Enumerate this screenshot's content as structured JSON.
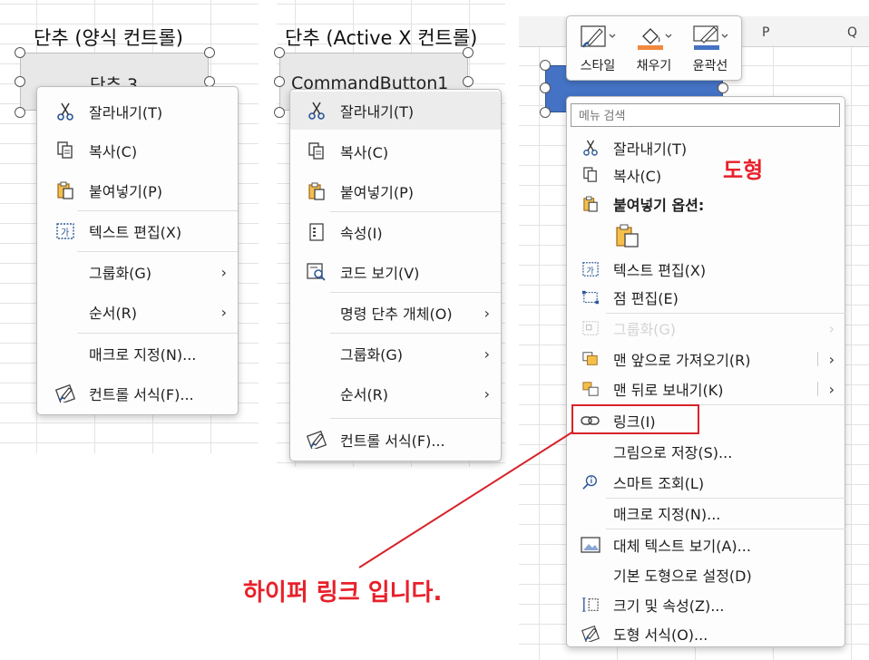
{
  "form_section": {
    "title": "단추 (양식 컨트롤)",
    "button_caption": "단추 3",
    "menu": [
      {
        "label": "잘라내기(T)",
        "icon": "scissors-icon"
      },
      {
        "label": "복사(C)",
        "icon": "copy-icon"
      },
      {
        "label": "붙여넣기(P)",
        "icon": "paste-icon"
      },
      {
        "label": "텍스트 편집(X)",
        "icon": "text-edit-icon"
      },
      {
        "label": "그룹화(G)",
        "submenu": true
      },
      {
        "label": "순서(R)",
        "submenu": true
      },
      {
        "label": "매크로 지정(N)..."
      },
      {
        "label": "컨트롤 서식(F)...",
        "icon": "format-brush-icon"
      }
    ]
  },
  "activex_section": {
    "title": "단추 (Active X 컨트롤)",
    "button_caption": "CommandButton1",
    "menu": [
      {
        "label": "잘라내기(T)",
        "icon": "scissors-icon"
      },
      {
        "label": "복사(C)",
        "icon": "copy-icon"
      },
      {
        "label": "붙여넣기(P)",
        "icon": "paste-icon"
      },
      {
        "label": "속성(I)",
        "icon": "properties-icon"
      },
      {
        "label": "코드 보기(V)",
        "icon": "view-code-icon"
      },
      {
        "label": "명령 단추 개체(O)",
        "submenu": true
      },
      {
        "label": "그룹화(G)",
        "submenu": true
      },
      {
        "label": "순서(R)",
        "submenu": true
      },
      {
        "label": "컨트롤 서식(F)...",
        "icon": "format-brush-icon"
      }
    ]
  },
  "shape_section": {
    "column_letters": [
      "P",
      "Q"
    ],
    "toolbar": [
      {
        "label": "스타일",
        "icon": "style-brush-icon"
      },
      {
        "label": "채우기",
        "icon": "fill-bucket-icon",
        "color": "#f0883e"
      },
      {
        "label": "윤곽선",
        "icon": "outline-pen-icon",
        "color": "#4472c4"
      }
    ],
    "shape_color": "#4472c4",
    "search_placeholder": "메뉴 검색",
    "menu": [
      {
        "label": "잘라내기(T)",
        "icon": "scissors-icon"
      },
      {
        "label": "복사(C)",
        "icon": "copy-icon"
      },
      {
        "label": "붙여넣기 옵션:",
        "icon": "paste-icon",
        "bold": true
      },
      {
        "label": "텍스트 편집(X)",
        "icon": "text-edit-icon"
      },
      {
        "label": "점 편집(E)",
        "icon": "edit-points-icon"
      },
      {
        "label": "그룹화(G)",
        "icon": "group-icon",
        "submenu": true,
        "disabled": true
      },
      {
        "label": "맨 앞으로 가져오기(R)",
        "icon": "bring-front-icon",
        "submenu": true
      },
      {
        "label": "맨 뒤로 보내기(K)",
        "icon": "send-back-icon",
        "submenu": true
      },
      {
        "label": "링크(I)",
        "icon": "link-icon"
      },
      {
        "label": "그림으로 저장(S)..."
      },
      {
        "label": "스마트 조회(L)",
        "icon": "smart-lookup-icon"
      },
      {
        "label": "매크로 지정(N)..."
      },
      {
        "label": "대체 텍스트 보기(A)...",
        "icon": "alt-text-icon"
      },
      {
        "label": "기본 도형으로 설정(D)"
      },
      {
        "label": "크기 및 속성(Z)...",
        "icon": "size-properties-icon"
      },
      {
        "label": "도형 서식(O)...",
        "icon": "format-brush-icon"
      }
    ]
  },
  "annotations": {
    "shape_label": "도형",
    "hyperlink_note": "하이퍼 링크 입니다.",
    "color": "#e8202a"
  }
}
